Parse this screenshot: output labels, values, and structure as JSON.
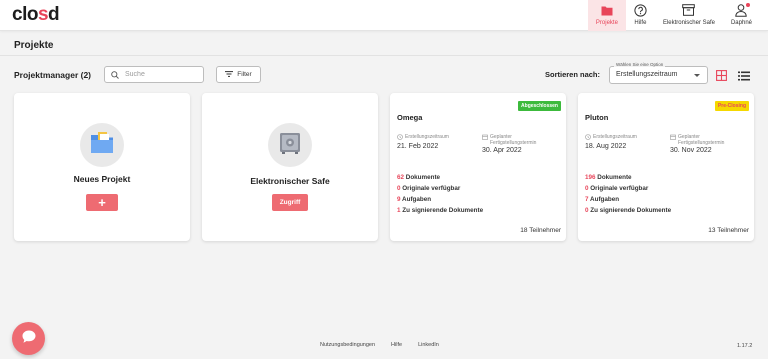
{
  "app": {
    "logo_text_a": "clo",
    "logo_text_b": "s",
    "logo_text_c": "d",
    "accent_color": "#e8455a"
  },
  "nav": {
    "items": [
      {
        "label": "Projekte",
        "icon": "folder-icon",
        "active": true
      },
      {
        "label": "Hilfe",
        "icon": "help-icon",
        "active": false
      },
      {
        "label": "Elektronischer Safe",
        "icon": "archive-icon",
        "active": false
      },
      {
        "label": "Daphné",
        "icon": "user-icon",
        "active": false
      }
    ]
  },
  "page": {
    "title": "Projekte"
  },
  "toolbar": {
    "manager_label": "Projektmanager (2)",
    "search_placeholder": "Suche",
    "filter_label": "Filter",
    "sort_label": "Sortieren nach:",
    "sort_legend": "Wählen Sie eine Option",
    "sort_value": "Erstellungszeitraum"
  },
  "cards": {
    "new_project": {
      "title": "Neues Projekt",
      "button": "+"
    },
    "safe": {
      "title": "Elektronischer Safe",
      "button": "Zugriff"
    },
    "projects": [
      {
        "name": "Omega",
        "status": "Abgeschlossen",
        "created_label": "Erstellungszeitraum",
        "created_date": "21. Feb 2022",
        "planned_label_1": "Geplanter",
        "planned_label_2": "Fertigstellungstermin",
        "planned_date": "30. Apr 2022",
        "documents_n": "62",
        "documents_l": "Dokumente",
        "originals_n": "0",
        "originals_l": "Originale verfügbar",
        "tasks_n": "9",
        "tasks_l": "Aufgaben",
        "sign_n": "1",
        "sign_l": "Zu signierende Dokumente",
        "members": "18 Teilnehmer"
      },
      {
        "name": "Pluton",
        "status": "Pre-Closing",
        "created_label": "Erstellungszeitraum",
        "created_date": "18. Aug 2022",
        "planned_label_1": "Geplanter",
        "planned_label_2": "Fertigstellungstermin",
        "planned_date": "30. Nov 2022",
        "documents_n": "196",
        "documents_l": "Dokumente",
        "originals_n": "0",
        "originals_l": "Originale verfügbar",
        "tasks_n": "7",
        "tasks_l": "Aufgaben",
        "sign_n": "0",
        "sign_l": "Zu signierende Dokumente",
        "members": "13 Teilnehmer"
      }
    ]
  },
  "footer": {
    "links": [
      "Nutzungsbedingungen",
      "Hilfe",
      "LinkedIn"
    ],
    "version": "1.17.2"
  }
}
